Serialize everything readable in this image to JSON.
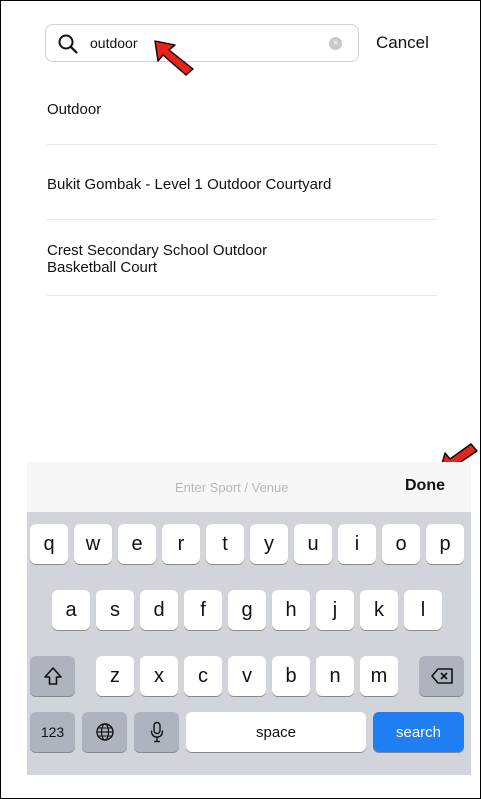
{
  "search": {
    "value": "outdoor",
    "cancel_label": "Cancel"
  },
  "results": [
    {
      "label": "Outdoor"
    },
    {
      "label": "Bukit Gombak - Level 1  Outdoor Courtyard"
    },
    {
      "label_line1": "Crest Secondary School Outdoor",
      "label_line2": "Basketball Court"
    }
  ],
  "keyboard": {
    "accessory_hint": "Enter Sport / Venue",
    "done_label": "Done",
    "row1": [
      "q",
      "w",
      "e",
      "r",
      "t",
      "y",
      "u",
      "i",
      "o",
      "p"
    ],
    "row2": [
      "a",
      "s",
      "d",
      "f",
      "g",
      "h",
      "j",
      "k",
      "l"
    ],
    "row3": [
      "z",
      "x",
      "c",
      "v",
      "b",
      "n",
      "m"
    ],
    "numbers_label": "123",
    "space_label": "space",
    "search_label": "search",
    "icons": {
      "shift": "shift-icon",
      "delete": "backspace-icon",
      "globe": "globe-icon",
      "mic": "microphone-icon"
    }
  },
  "colors": {
    "annotation_arrow": "#e8231b",
    "search_key": "#1f7ef2"
  }
}
